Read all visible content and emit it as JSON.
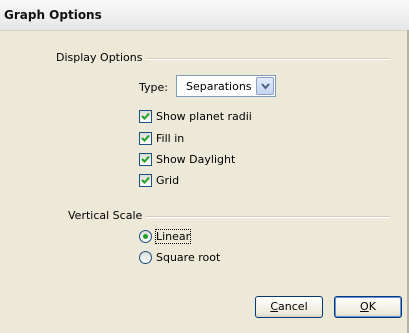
{
  "window": {
    "title": "Graph Options"
  },
  "display_options": {
    "section_label": "Display Options",
    "type_label": "Type:",
    "type_value": "Separations",
    "checkboxes": [
      {
        "label": "Show planet radii",
        "checked": true
      },
      {
        "label": "Fill in",
        "checked": true
      },
      {
        "label": "Show Daylight",
        "checked": true
      },
      {
        "label": "Grid",
        "checked": true
      }
    ]
  },
  "vertical_scale": {
    "section_label": "Vertical Scale",
    "options": [
      {
        "label": "Linear",
        "selected": true
      },
      {
        "label": "Square root",
        "selected": false
      }
    ]
  },
  "buttons": {
    "cancel": {
      "mnemonic": "C",
      "rest": "ancel"
    },
    "ok": {
      "mnemonic": "O",
      "rest": "K"
    }
  },
  "colors": {
    "check_mark": "#21a121",
    "border": "#1c5180",
    "field_border": "#7f9db9"
  }
}
